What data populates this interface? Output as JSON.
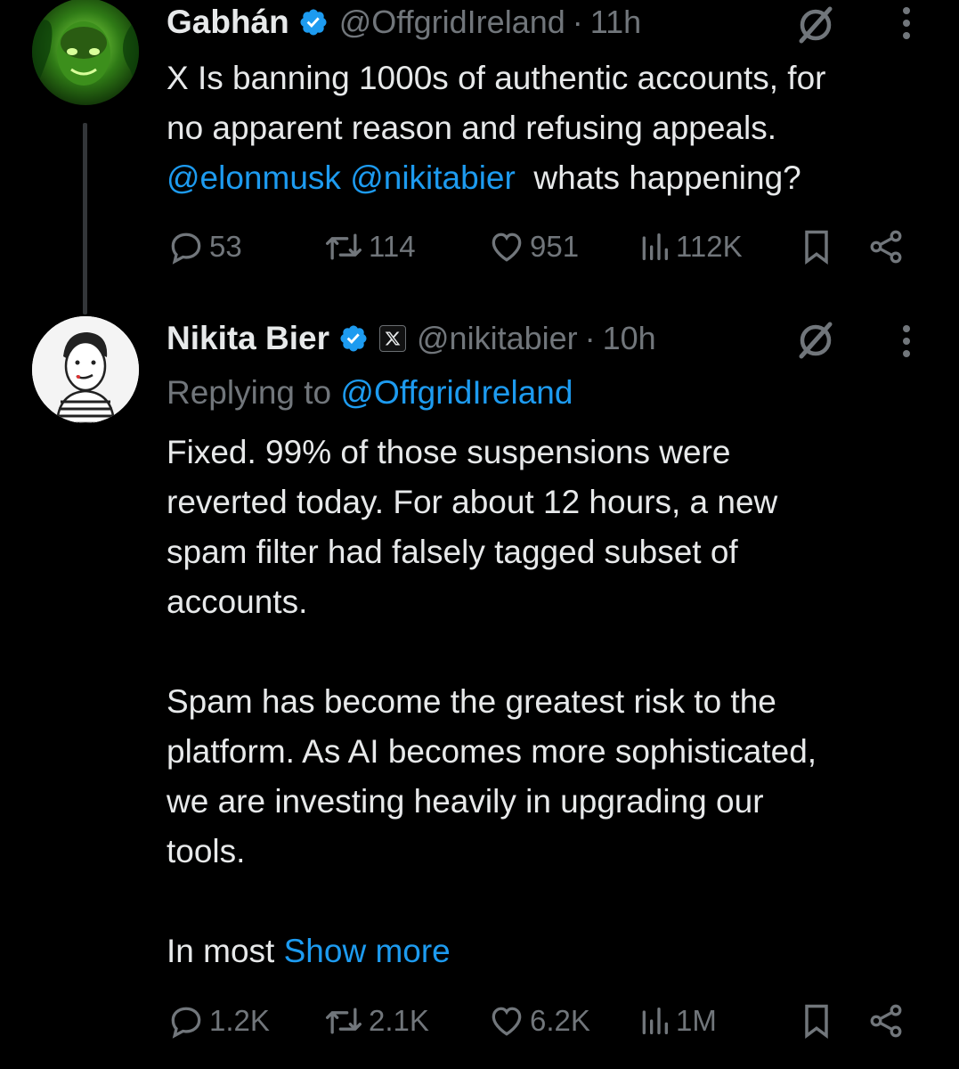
{
  "tweets": [
    {
      "author_name": "Gabhán",
      "handle": "@OffgridIreland",
      "separator": "·",
      "time": "11h",
      "text_line1": "X Is banning 1000s of authentic accounts, for",
      "text_line2": "no apparent reason and refusing appeals.",
      "mention1": "@elonmusk",
      "mention2": "@nikitabier",
      "text_after_mentions": "whats happening?",
      "replies": "53",
      "reposts": "114",
      "likes": "951",
      "views": "112K"
    },
    {
      "author_name": "Nikita Bier",
      "affiliation_badge": "X",
      "handle": "@nikitabier",
      "separator": "·",
      "time": "10h",
      "replying_prefix": "Replying to",
      "replying_to": "@OffgridIreland",
      "paragraph1": [
        "Fixed. 99% of those suspensions were",
        "reverted today. For about 12 hours, a new",
        "spam filter had falsely tagged subset of",
        "accounts."
      ],
      "paragraph2": [
        "Spam has become the greatest risk to the",
        "platform. As AI becomes more sophisticated,",
        "we are investing heavily in upgrading our",
        "tools."
      ],
      "truncated_text": "In most",
      "show_more": "Show more",
      "replies": "1.2K",
      "reposts": "2.1K",
      "likes": "6.2K",
      "views": "1M"
    }
  ],
  "colors": {
    "background": "#000000",
    "text_primary": "#e7e9ea",
    "text_secondary": "#71767b",
    "link": "#1d9bf0",
    "verified": "#1d9bf0"
  },
  "icons": [
    "verified-badge-icon",
    "grok-icon",
    "more-options-icon",
    "reply-icon",
    "repost-icon",
    "like-icon",
    "views-icon",
    "bookmark-icon",
    "share-icon"
  ]
}
